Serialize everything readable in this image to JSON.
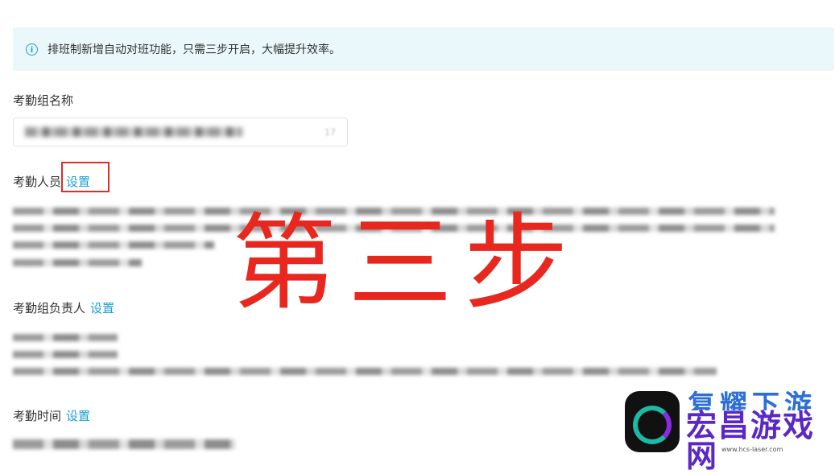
{
  "banner": {
    "icon": "info-icon",
    "icon_glyph": "i",
    "text": "排班制新增自动对班功能，只需三步开启，大幅提升效率。"
  },
  "group_name": {
    "label": "考勤组名称",
    "char_count": "17"
  },
  "members": {
    "label": "考勤人员",
    "link": "设置"
  },
  "owner": {
    "label": "考勤组负责人",
    "link": "设置"
  },
  "time": {
    "label": "考勤时间",
    "link": "设置"
  },
  "overlay": {
    "text": "第三步",
    "color": "#e8281f"
  },
  "watermark": {
    "top_text": "复耀下游",
    "title": "宏昌游戏网",
    "url": "www.hcs-laser.com"
  },
  "colors": {
    "accent": "#1aa0d8",
    "banner_bg": "#eaf7fb",
    "highlight": "#e02b2b"
  }
}
